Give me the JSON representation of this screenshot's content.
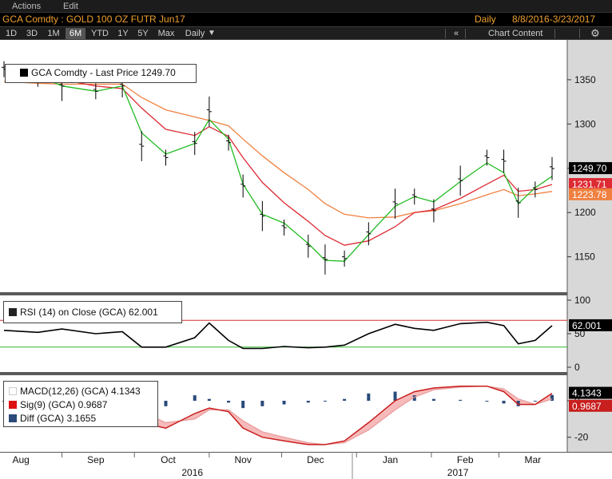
{
  "menu": {
    "actions": "Actions",
    "edit": "Edit"
  },
  "title": {
    "security": "GCA Comdty : GOLD 100 OZ FUTR  Jun17",
    "period": "Daily",
    "range": "8/8/2016-3/23/2017"
  },
  "toolbar": {
    "ranges": [
      "1D",
      "3D",
      "1M",
      "6M",
      "YTD",
      "1Y",
      "5Y",
      "Max"
    ],
    "active_range": "6M",
    "period_select": "Daily",
    "period_arrow": "▼",
    "collapse": "«",
    "chart_content_icon": "chart-content-icon",
    "chart_content": "Chart Content",
    "draw_icon": "draw-icon",
    "gear_icon": "gear-icon"
  },
  "price_panel": {
    "legend": "GCA Comdty - Last Price 1249.70",
    "y_ticks": [
      "1350",
      "1300",
      "1250",
      "1200",
      "1150"
    ],
    "badges": [
      "1249.70",
      "1231.71",
      "1223.78"
    ]
  },
  "rsi_panel": {
    "legend": "RSI (14) on Close (GCA) 62.001",
    "y_ticks": [
      "100",
      "50",
      "0"
    ],
    "badge": "62.001"
  },
  "macd_panel": {
    "legend": [
      "MACD(12,26) (GCA) 4.1343",
      "Sig(9) (GCA) 0.9687",
      "Diff (GCA) 3.1655"
    ],
    "y_ticks": [
      "0",
      "-20"
    ],
    "badges": [
      "4.1343",
      "0.9687"
    ]
  },
  "x_axis": {
    "months": [
      "Aug",
      "Sep",
      "Oct",
      "Nov",
      "Dec",
      "Jan",
      "Feb",
      "Mar"
    ],
    "years": [
      "2016",
      "2017"
    ]
  },
  "colors": {
    "accent": "#f0a030",
    "price_bar": "#000000",
    "ema_fast": "#22bb22",
    "ma_mid": "#dd2a33",
    "ma_slow": "#f08040",
    "rsi_upper": "#d23030",
    "rsi_lower": "#2cb82c",
    "macd_line": "#c81e1e",
    "macd_fill": "#f4a3a3",
    "diff_bar": "#2a4a7a"
  },
  "chart_data": [
    {
      "type": "line",
      "title": "GCA Comdty - Last Price 1249.70",
      "x_range": [
        "2016-08-08",
        "2017-03-23"
      ],
      "ylim": [
        1110,
        1395
      ],
      "series": [
        {
          "name": "GCA Comdty - Last Price",
          "style": "ohlc",
          "color": "#000000",
          "x": [
            "2016-08-08",
            "2016-08-22",
            "2016-09-01",
            "2016-09-15",
            "2016-09-26",
            "2016-10-04",
            "2016-10-14",
            "2016-10-26",
            "2016-11-01",
            "2016-11-09",
            "2016-11-15",
            "2016-11-23",
            "2016-12-02",
            "2016-12-12",
            "2016-12-19",
            "2016-12-27",
            "2017-01-06",
            "2017-01-17",
            "2017-01-25",
            "2017-02-02",
            "2017-02-13",
            "2017-02-24",
            "2017-03-03",
            "2017-03-09",
            "2017-03-16",
            "2017-03-23"
          ],
          "values": [
            1362,
            1355,
            1343,
            1337,
            1343,
            1275,
            1262,
            1278,
            1314,
            1279,
            1230,
            1196,
            1183,
            1162,
            1147,
            1148,
            1176,
            1210,
            1218,
            1202,
            1236,
            1262,
            1258,
            1211,
            1226,
            1249.7
          ]
        },
        {
          "name": "MA 1",
          "color": "#22bb22",
          "values": [
            1362,
            1355,
            1343,
            1337,
            1343,
            1290,
            1266,
            1278,
            1305,
            1283,
            1232,
            1198,
            1188,
            1165,
            1146,
            1145,
            1175,
            1207,
            1218,
            1212,
            1235,
            1256,
            1245,
            1210,
            1228,
            1241
          ]
        },
        {
          "name": "MA 2",
          "color": "#dd2a33",
          "values": [
            1365,
            1358,
            1350,
            1343,
            1340,
            1318,
            1294,
            1287,
            1297,
            1286,
            1262,
            1234,
            1211,
            1190,
            1174,
            1163,
            1168,
            1184,
            1200,
            1203,
            1216,
            1232,
            1242,
            1224,
            1226,
            1231.71
          ]
        },
        {
          "name": "MA 3",
          "color": "#f08040",
          "values": [
            1348,
            1346,
            1345,
            1345,
            1345,
            1330,
            1316,
            1308,
            1304,
            1298,
            1283,
            1264,
            1245,
            1226,
            1210,
            1198,
            1194,
            1195,
            1200,
            1202,
            1210,
            1220,
            1226,
            1219,
            1221,
            1223.78
          ]
        }
      ],
      "y_ticks": [
        1350,
        1300,
        1250,
        1200,
        1150
      ]
    },
    {
      "type": "line",
      "title": "RSI (14) on Close (GCA) 62.001",
      "ylim": [
        0,
        100
      ],
      "reference_lines": [
        70,
        30
      ],
      "series": [
        {
          "name": "RSI (14)",
          "color": "#000000",
          "values": [
            55,
            52,
            57,
            50,
            53,
            30,
            30,
            44,
            66,
            40,
            28,
            28,
            31,
            29,
            30,
            33,
            50,
            64,
            58,
            55,
            65,
            67,
            62,
            35,
            40,
            62.001
          ]
        }
      ],
      "y_ticks": [
        100,
        50,
        0
      ]
    },
    {
      "type": "area",
      "title": "MACD(12,26) (GCA) 4.1343",
      "ylim": [
        -28,
        14
      ],
      "series": [
        {
          "name": "MACD(12,26) (GCA)",
          "color": "#c81e1e",
          "values": [
            -2,
            -2.5,
            -3,
            -3.5,
            -3,
            -12,
            -15,
            -7,
            -4,
            -6,
            -15,
            -20,
            -22,
            -24,
            -24,
            -22,
            -12,
            0,
            5,
            7,
            8,
            8,
            5,
            -2,
            -2,
            4.1343
          ]
        },
        {
          "name": "Sig(9) (GCA)",
          "color": "#f4a3a3",
          "values": [
            -1.5,
            -2,
            -2.5,
            -3,
            -3,
            -6,
            -12,
            -10,
            -5,
            -5,
            -11,
            -17,
            -20,
            -23,
            -24,
            -23,
            -16,
            -5,
            2,
            6,
            7.5,
            8,
            6.5,
            1,
            -2,
            0.9687
          ]
        },
        {
          "name": "Diff (GCA)",
          "style": "bar",
          "color": "#2a4a7a",
          "values": [
            -0.5,
            -0.5,
            -0.5,
            -0.5,
            0,
            -6,
            -3,
            3,
            1,
            -1,
            -4,
            -3,
            -2,
            -1,
            0,
            1,
            4,
            5,
            3,
            1,
            0.5,
            0,
            -1.5,
            -3,
            0,
            3.1655
          ]
        }
      ],
      "y_ticks": [
        0,
        -20
      ]
    }
  ]
}
